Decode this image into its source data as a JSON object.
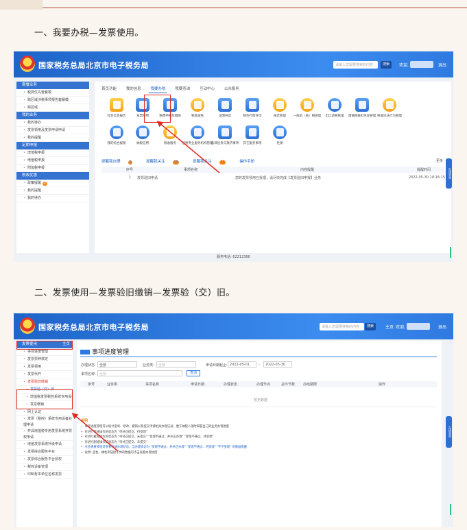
{
  "article": {
    "step1": "一、我要办税—发票使用。",
    "step2": "二、发票使用—发票验旧缴销—发票验（交）旧。"
  },
  "portal": {
    "title": "国家税务总局北京市电子税务局",
    "search_placeholder": "请输入您需要搜索的内容",
    "search_btn": "搜索",
    "welcome": "欢迎,",
    "home": "主页",
    "logout": "退出",
    "footer_phone": "服务电话: 62212366"
  },
  "shot1": {
    "sidebar": {
      "sec1": "套餐业务",
      "s1": [
        "税费优先套餐模",
        "跨区域涉税事项报告套餐模",
        "跨区域..."
      ],
      "sec2": "我的业务",
      "s2": [
        "我的待办",
        "发票领用及发票申请申请",
        "我的提醒"
      ],
      "sec3": "定期申报",
      "s3": [
        "增值税申报",
        "增值税申报",
        "附加税申报"
      ],
      "sec4": "税收优惠",
      "s4": [
        "政策提醒",
        "我的提醒",
        "我的待办"
      ],
      "badge": "2"
    },
    "tabs": [
      "首页功能",
      "我的信息",
      "我要办税",
      "我要查询",
      "互动中心",
      "公众服务"
    ],
    "icons": [
      "综合信息报告",
      "发票使用",
      "税费申报及缴纳",
      "税收减免",
      "证明开具",
      "税务行政许可",
      "核定管理",
      "一般退（抵）税管理",
      "出口退税管理",
      "增值税抵扣凭证管理",
      "税收违法行为管理",
      "我的综合报税",
      "纳税信用",
      "税收服务",
      "涉税专业服务机构管理",
      "法律追责与救济事项",
      "其它服务事项",
      "社保"
    ],
    "subtabs": [
      "提醒我办理",
      "提醒我关注",
      "提醒我关注",
      "操作手册"
    ],
    "subtab_badges": [
      "1",
      "10",
      "11"
    ],
    "table_head": [
      "序号",
      "事项名称",
      "内容提醒",
      "提醒时间"
    ],
    "row": [
      "1",
      "发票验旧申请",
      "您的发票领用已受理，请尽快完成【发票验旧申报】业务",
      "2022-05-30 10:16:15"
    ],
    "more": "更多",
    "float_label": "在线咨询"
  },
  "shot2": {
    "sidebar": {
      "head": "发票使用",
      "head_right": "主页",
      "items": [
        "事项进度管理",
        "发票票种核定",
        "发票领用",
        "发票代开",
        "发票验旧缴销",
        "发票验（交）旧",
        "增值税发票税控系统专用设备申请",
        "发票缴销",
        "网上认证",
        "发票（税控）系统专用设备处理申请",
        "开具增值税专用发票系统开票权申请",
        "增值发票系统升级申请",
        "发票综合服务平台",
        "发票综合服务平台授权",
        "税控设备管理",
        "印制有本单位名称发票"
      ]
    },
    "panel_title": "事项进度管理",
    "filters": {
      "status_label": "办理状态:",
      "status_val": "全部",
      "type_label": "业务类:",
      "type_val": "全部",
      "date_label": "申请日期起止:",
      "date_from": "2022-05-01",
      "date_to": "2022-05-30",
      "name_label": "事项名称:",
      "name_val": "全部",
      "query_btn": "查询"
    },
    "columns": [
      "序号",
      "业务类",
      "事项名称",
      "申请日期",
      "办理状态",
      "办理节点",
      "总环节数",
      "办结期限",
      "操作"
    ],
    "empty": "暂无数据",
    "notes_title": "说明",
    "notes": [
      "事项进度管理可以统计查询、修改、撤销以及提交申请相关办理记录，便于纳税人随时掌握自己的业务办理进度",
      "对进行审核操作的状态为 \"待补正提交、待受理\"",
      "对进行撤回操作的状态为 \"待补正提交、未提交\" \"受理不通过、并补正办理\" \"受理不通过、待受理\"",
      "对进行删除操作的状态为 \"待补正提交、未提交\"",
      "点击查看按钮可查看申请办理状态，当办理状态为 \"受理不通过、并补正办理\" \"受理不通过、待受理\" \"不予受理\" 的数据提醒",
      "说明: 蓝色、橘色带链接字体的数据可点击查看办理进度"
    ],
    "float_label": "在线咨询"
  },
  "colors": {
    "header": "#2f7ae0",
    "highlight": "#e02a20",
    "accent": "#1f64c8"
  }
}
